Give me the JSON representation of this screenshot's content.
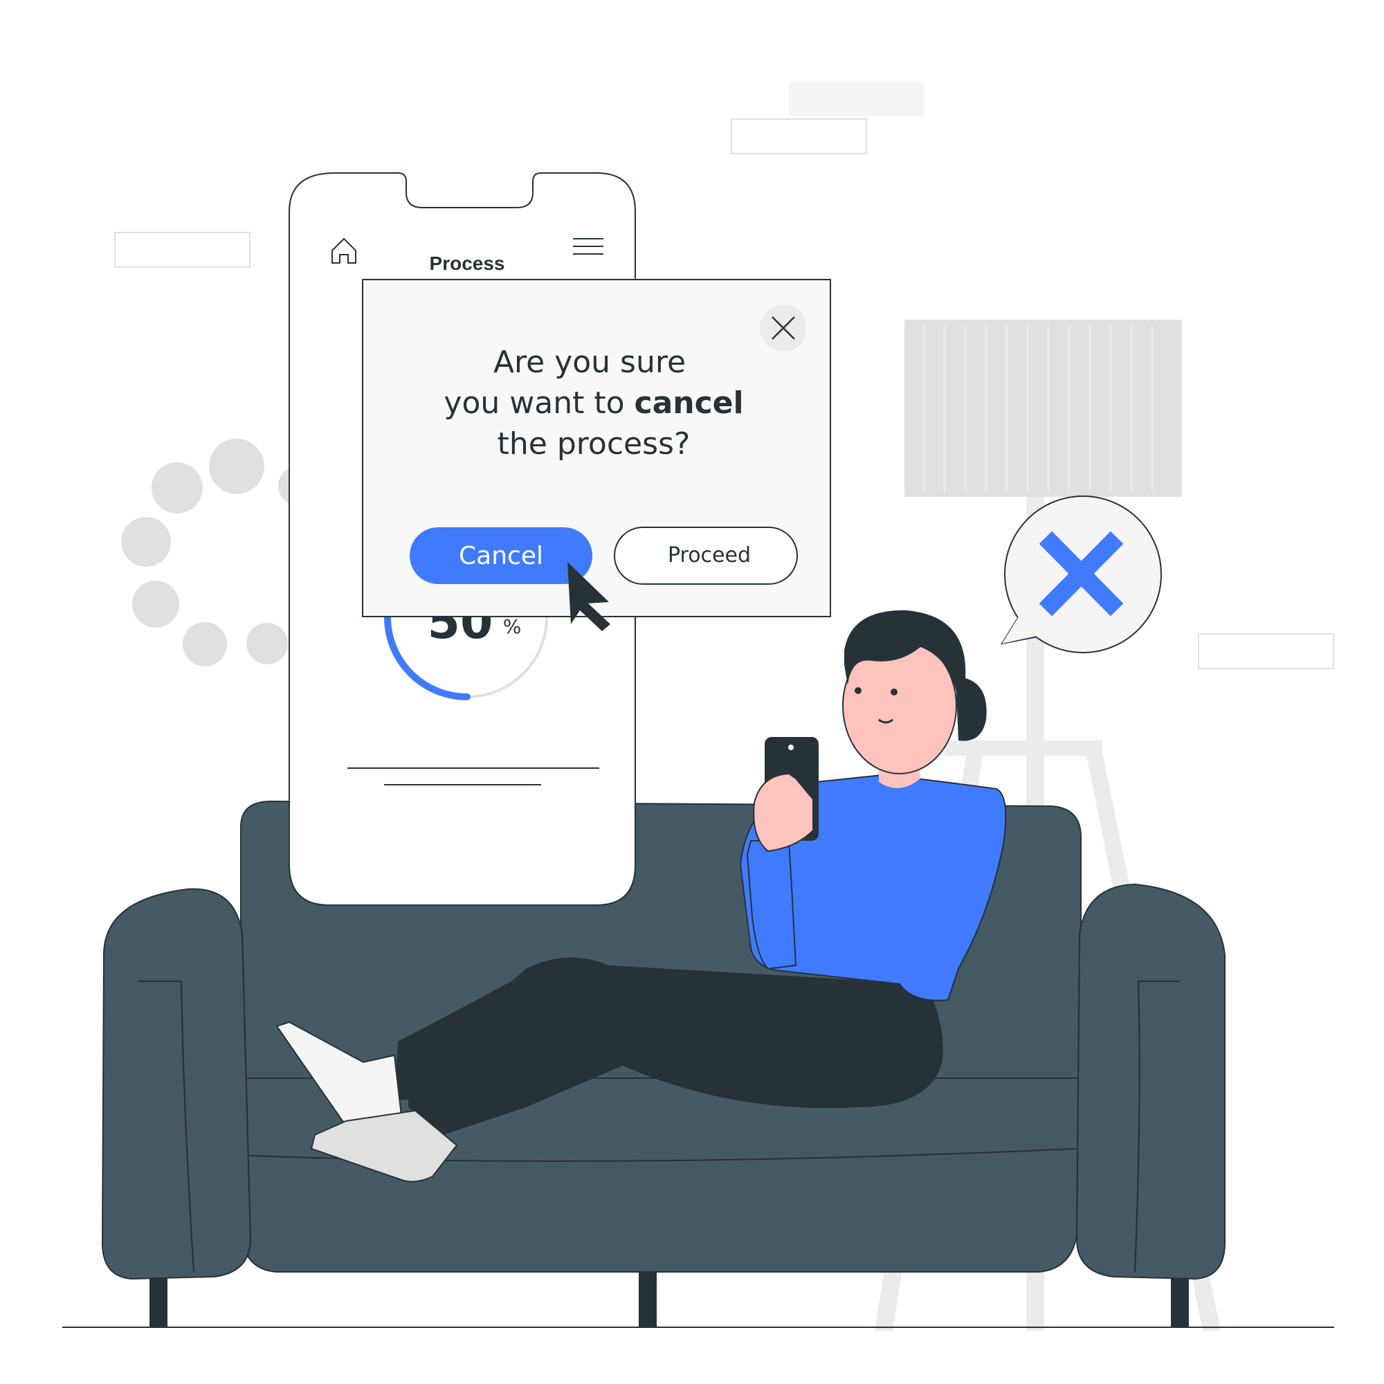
{
  "phone": {
    "title": "Process",
    "progress_percent": 50,
    "progress_value": "50",
    "progress_unit": "%"
  },
  "dialog": {
    "line1": "Are you sure",
    "line2_prefix": "you want to ",
    "line2_emphasis": "cancel",
    "line3": "the process?",
    "cancel_label": "Cancel",
    "proceed_label": "Proceed"
  },
  "icons": {
    "home": "home-icon",
    "menu": "hamburger-menu-icon",
    "close": "close-icon",
    "cursor": "mouse-cursor-icon",
    "bubble": "x-mark-icon"
  },
  "colors": {
    "accent": "#407BFF",
    "dark": "#263238",
    "sofa": "#455A64",
    "skin": "#FFC3BD",
    "light_gray": "#E0E0E0"
  }
}
